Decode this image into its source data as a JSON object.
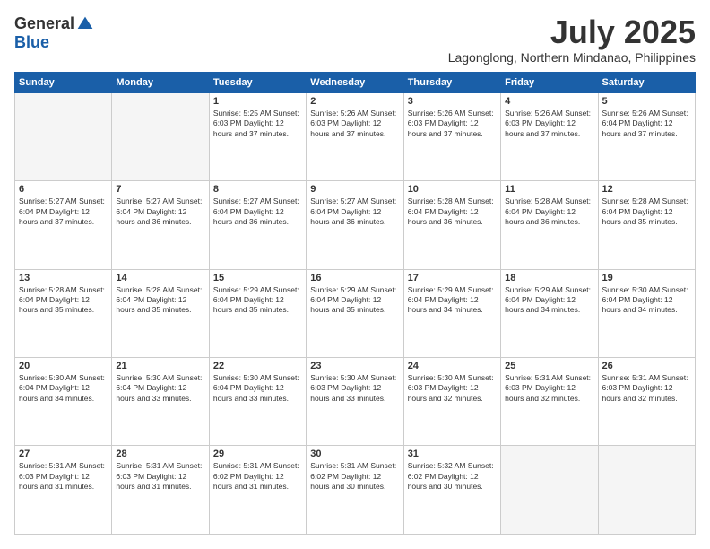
{
  "logo": {
    "general": "General",
    "blue": "Blue"
  },
  "title": {
    "month": "July 2025",
    "location": "Lagonglong, Northern Mindanao, Philippines"
  },
  "weekdays": [
    "Sunday",
    "Monday",
    "Tuesday",
    "Wednesday",
    "Thursday",
    "Friday",
    "Saturday"
  ],
  "weeks": [
    [
      {
        "day": "",
        "info": ""
      },
      {
        "day": "",
        "info": ""
      },
      {
        "day": "1",
        "info": "Sunrise: 5:25 AM\nSunset: 6:03 PM\nDaylight: 12 hours and 37 minutes."
      },
      {
        "day": "2",
        "info": "Sunrise: 5:26 AM\nSunset: 6:03 PM\nDaylight: 12 hours and 37 minutes."
      },
      {
        "day": "3",
        "info": "Sunrise: 5:26 AM\nSunset: 6:03 PM\nDaylight: 12 hours and 37 minutes."
      },
      {
        "day": "4",
        "info": "Sunrise: 5:26 AM\nSunset: 6:03 PM\nDaylight: 12 hours and 37 minutes."
      },
      {
        "day": "5",
        "info": "Sunrise: 5:26 AM\nSunset: 6:04 PM\nDaylight: 12 hours and 37 minutes."
      }
    ],
    [
      {
        "day": "6",
        "info": "Sunrise: 5:27 AM\nSunset: 6:04 PM\nDaylight: 12 hours and 37 minutes."
      },
      {
        "day": "7",
        "info": "Sunrise: 5:27 AM\nSunset: 6:04 PM\nDaylight: 12 hours and 36 minutes."
      },
      {
        "day": "8",
        "info": "Sunrise: 5:27 AM\nSunset: 6:04 PM\nDaylight: 12 hours and 36 minutes."
      },
      {
        "day": "9",
        "info": "Sunrise: 5:27 AM\nSunset: 6:04 PM\nDaylight: 12 hours and 36 minutes."
      },
      {
        "day": "10",
        "info": "Sunrise: 5:28 AM\nSunset: 6:04 PM\nDaylight: 12 hours and 36 minutes."
      },
      {
        "day": "11",
        "info": "Sunrise: 5:28 AM\nSunset: 6:04 PM\nDaylight: 12 hours and 36 minutes."
      },
      {
        "day": "12",
        "info": "Sunrise: 5:28 AM\nSunset: 6:04 PM\nDaylight: 12 hours and 35 minutes."
      }
    ],
    [
      {
        "day": "13",
        "info": "Sunrise: 5:28 AM\nSunset: 6:04 PM\nDaylight: 12 hours and 35 minutes."
      },
      {
        "day": "14",
        "info": "Sunrise: 5:28 AM\nSunset: 6:04 PM\nDaylight: 12 hours and 35 minutes."
      },
      {
        "day": "15",
        "info": "Sunrise: 5:29 AM\nSunset: 6:04 PM\nDaylight: 12 hours and 35 minutes."
      },
      {
        "day": "16",
        "info": "Sunrise: 5:29 AM\nSunset: 6:04 PM\nDaylight: 12 hours and 35 minutes."
      },
      {
        "day": "17",
        "info": "Sunrise: 5:29 AM\nSunset: 6:04 PM\nDaylight: 12 hours and 34 minutes."
      },
      {
        "day": "18",
        "info": "Sunrise: 5:29 AM\nSunset: 6:04 PM\nDaylight: 12 hours and 34 minutes."
      },
      {
        "day": "19",
        "info": "Sunrise: 5:30 AM\nSunset: 6:04 PM\nDaylight: 12 hours and 34 minutes."
      }
    ],
    [
      {
        "day": "20",
        "info": "Sunrise: 5:30 AM\nSunset: 6:04 PM\nDaylight: 12 hours and 34 minutes."
      },
      {
        "day": "21",
        "info": "Sunrise: 5:30 AM\nSunset: 6:04 PM\nDaylight: 12 hours and 33 minutes."
      },
      {
        "day": "22",
        "info": "Sunrise: 5:30 AM\nSunset: 6:04 PM\nDaylight: 12 hours and 33 minutes."
      },
      {
        "day": "23",
        "info": "Sunrise: 5:30 AM\nSunset: 6:03 PM\nDaylight: 12 hours and 33 minutes."
      },
      {
        "day": "24",
        "info": "Sunrise: 5:30 AM\nSunset: 6:03 PM\nDaylight: 12 hours and 32 minutes."
      },
      {
        "day": "25",
        "info": "Sunrise: 5:31 AM\nSunset: 6:03 PM\nDaylight: 12 hours and 32 minutes."
      },
      {
        "day": "26",
        "info": "Sunrise: 5:31 AM\nSunset: 6:03 PM\nDaylight: 12 hours and 32 minutes."
      }
    ],
    [
      {
        "day": "27",
        "info": "Sunrise: 5:31 AM\nSunset: 6:03 PM\nDaylight: 12 hours and 31 minutes."
      },
      {
        "day": "28",
        "info": "Sunrise: 5:31 AM\nSunset: 6:03 PM\nDaylight: 12 hours and 31 minutes."
      },
      {
        "day": "29",
        "info": "Sunrise: 5:31 AM\nSunset: 6:02 PM\nDaylight: 12 hours and 31 minutes."
      },
      {
        "day": "30",
        "info": "Sunrise: 5:31 AM\nSunset: 6:02 PM\nDaylight: 12 hours and 30 minutes."
      },
      {
        "day": "31",
        "info": "Sunrise: 5:32 AM\nSunset: 6:02 PM\nDaylight: 12 hours and 30 minutes."
      },
      {
        "day": "",
        "info": ""
      },
      {
        "day": "",
        "info": ""
      }
    ]
  ]
}
